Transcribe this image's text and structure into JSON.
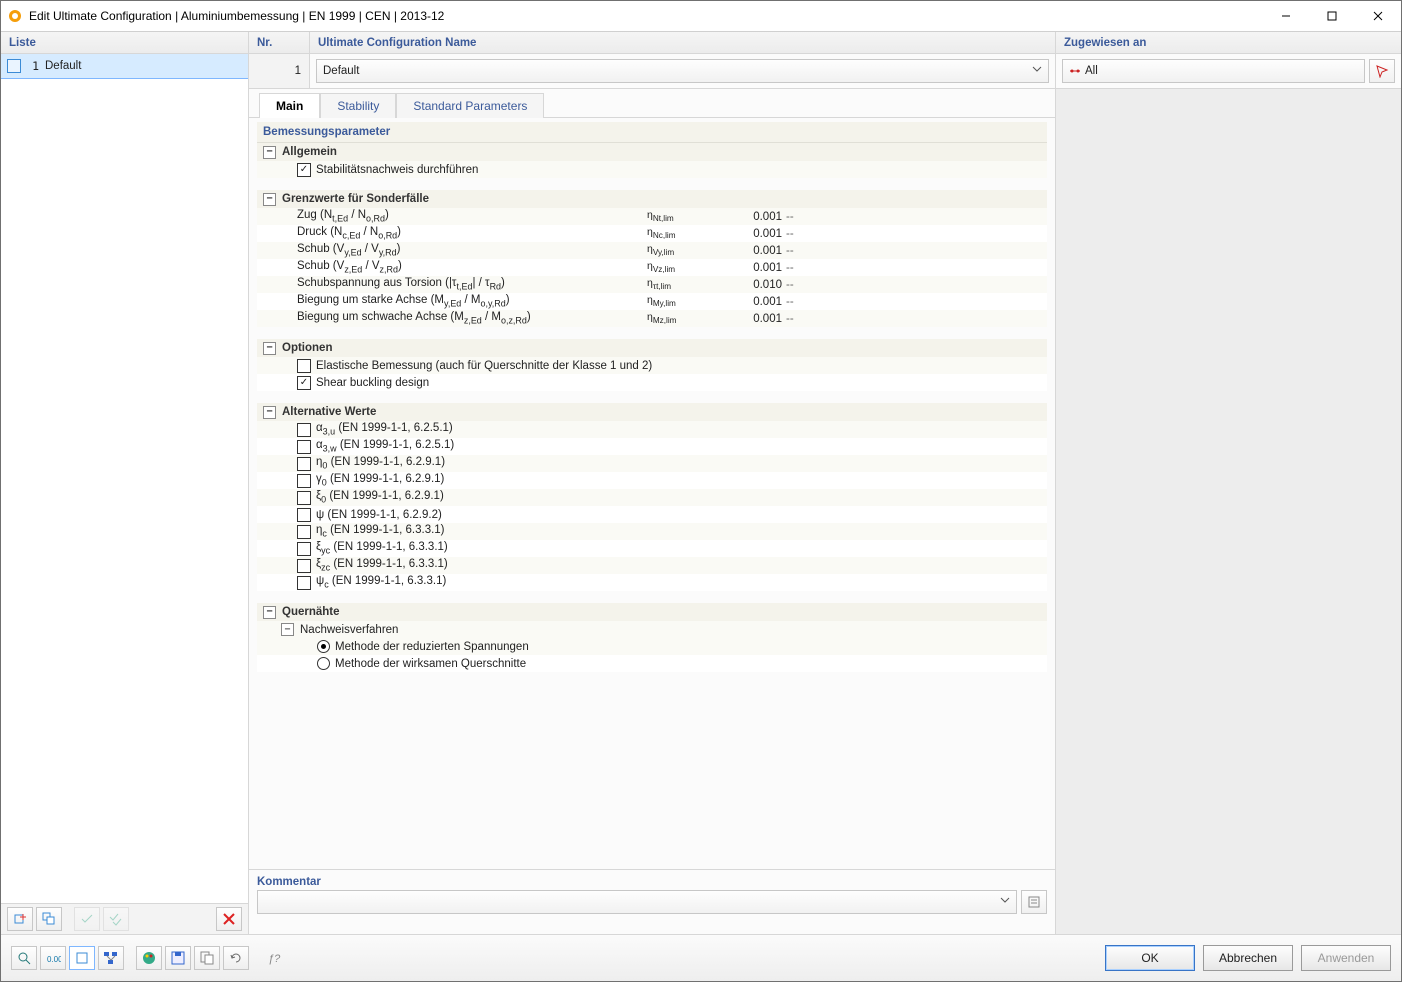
{
  "window": {
    "title": "Edit Ultimate Configuration | Aluminiumbemessung | EN 1999 | CEN | 2013-12"
  },
  "left": {
    "header": "Liste",
    "items": [
      {
        "num": "1",
        "label": "Default",
        "selected": true
      }
    ]
  },
  "top": {
    "nr_label": "Nr.",
    "nr_value": "1",
    "name_label": "Ultimate Configuration Name",
    "name_value": "Default",
    "assign_label": "Zugewiesen an",
    "assign_value": "All"
  },
  "tabs": [
    {
      "label": "Main",
      "active": true
    },
    {
      "label": "Stability",
      "active": false
    },
    {
      "label": "Standard Parameters",
      "active": false
    }
  ],
  "params": {
    "header": "Bemessungsparameter",
    "allgemein": {
      "title": "Allgemein",
      "items": [
        {
          "label": "Stabilitätsnachweis durchführen",
          "checked": true
        }
      ]
    },
    "grenzwerte": {
      "title": "Grenzwerte für Sonderfälle",
      "rows": [
        {
          "label": "Zug (N<sub>t,Ed</sub> / N<sub>o,Rd</sub>)",
          "sym": "η<sub>Nt,lim</sub>",
          "val": "0.001",
          "unit": "--"
        },
        {
          "label": "Druck (N<sub>c,Ed</sub> / N<sub>o,Rd</sub>)",
          "sym": "η<sub>Nc,lim</sub>",
          "val": "0.001",
          "unit": "--"
        },
        {
          "label": "Schub (V<sub>y,Ed</sub> / V<sub>y,Rd</sub>)",
          "sym": "η<sub>Vy,lim</sub>",
          "val": "0.001",
          "unit": "--"
        },
        {
          "label": "Schub (V<sub>z,Ed</sub> / V<sub>z,Rd</sub>)",
          "sym": "η<sub>Vz,lim</sub>",
          "val": "0.001",
          "unit": "--"
        },
        {
          "label": "Schubspannung aus Torsion (|τ<sub>t,Ed</sub>| / τ<sub>Rd</sub>)",
          "sym": "η<sub>τt,lim</sub>",
          "val": "0.010",
          "unit": "--"
        },
        {
          "label": "Biegung um starke Achse (M<sub>y,Ed</sub> / M<sub>o,y,Rd</sub>)",
          "sym": "η<sub>My,lim</sub>",
          "val": "0.001",
          "unit": "--"
        },
        {
          "label": "Biegung um schwache Achse (M<sub>z,Ed</sub> / M<sub>o,z,Rd</sub>)",
          "sym": "η<sub>Mz,lim</sub>",
          "val": "0.001",
          "unit": "--"
        }
      ]
    },
    "optionen": {
      "title": "Optionen",
      "items": [
        {
          "label": "Elastische Bemessung (auch für Querschnitte der Klasse 1 und 2)",
          "checked": false
        },
        {
          "label": "Shear buckling design",
          "checked": true
        }
      ]
    },
    "alt": {
      "title": "Alternative Werte",
      "items": [
        {
          "label": "α<sub>3,u</sub> (EN 1999-1-1, 6.2.5.1)",
          "checked": false
        },
        {
          "label": "α<sub>3,w</sub> (EN 1999-1-1, 6.2.5.1)",
          "checked": false
        },
        {
          "label": "η<sub>0</sub> (EN 1999-1-1, 6.2.9.1)",
          "checked": false
        },
        {
          "label": "γ<sub>0</sub> (EN 1999-1-1, 6.2.9.1)",
          "checked": false
        },
        {
          "label": "ξ<sub>0</sub> (EN 1999-1-1, 6.2.9.1)",
          "checked": false
        },
        {
          "label": "ψ (EN 1999-1-1, 6.2.9.2)",
          "checked": false
        },
        {
          "label": "η<sub>c</sub> (EN 1999-1-1, 6.3.3.1)",
          "checked": false
        },
        {
          "label": "ξ<sub>yc</sub> (EN 1999-1-1, 6.3.3.1)",
          "checked": false
        },
        {
          "label": "ξ<sub>zc</sub> (EN 1999-1-1, 6.3.3.1)",
          "checked": false
        },
        {
          "label": "ψ<sub>c</sub> (EN 1999-1-1, 6.3.3.1)",
          "checked": false
        }
      ]
    },
    "quer": {
      "title": "Quernähte",
      "subtitle": "Nachweisverfahren",
      "radios": [
        {
          "label": "Methode der reduzierten Spannungen",
          "checked": true
        },
        {
          "label": "Methode der wirksamen Querschnitte",
          "checked": false
        }
      ]
    }
  },
  "comment": {
    "label": "Kommentar",
    "value": ""
  },
  "footer": {
    "ok": "OK",
    "cancel": "Abbrechen",
    "apply": "Anwenden"
  }
}
